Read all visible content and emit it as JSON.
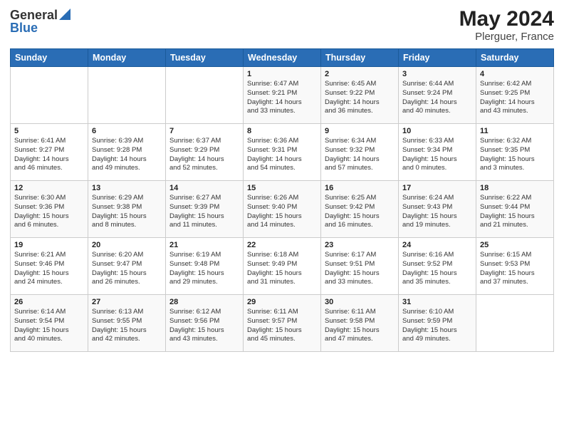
{
  "logo": {
    "general": "General",
    "blue": "Blue"
  },
  "title": {
    "month_year": "May 2024",
    "location": "Plerguer, France"
  },
  "headers": [
    "Sunday",
    "Monday",
    "Tuesday",
    "Wednesday",
    "Thursday",
    "Friday",
    "Saturday"
  ],
  "weeks": [
    [
      {
        "day": "",
        "info": ""
      },
      {
        "day": "",
        "info": ""
      },
      {
        "day": "",
        "info": ""
      },
      {
        "day": "1",
        "info": "Sunrise: 6:47 AM\nSunset: 9:21 PM\nDaylight: 14 hours\nand 33 minutes."
      },
      {
        "day": "2",
        "info": "Sunrise: 6:45 AM\nSunset: 9:22 PM\nDaylight: 14 hours\nand 36 minutes."
      },
      {
        "day": "3",
        "info": "Sunrise: 6:44 AM\nSunset: 9:24 PM\nDaylight: 14 hours\nand 40 minutes."
      },
      {
        "day": "4",
        "info": "Sunrise: 6:42 AM\nSunset: 9:25 PM\nDaylight: 14 hours\nand 43 minutes."
      }
    ],
    [
      {
        "day": "5",
        "info": "Sunrise: 6:41 AM\nSunset: 9:27 PM\nDaylight: 14 hours\nand 46 minutes."
      },
      {
        "day": "6",
        "info": "Sunrise: 6:39 AM\nSunset: 9:28 PM\nDaylight: 14 hours\nand 49 minutes."
      },
      {
        "day": "7",
        "info": "Sunrise: 6:37 AM\nSunset: 9:29 PM\nDaylight: 14 hours\nand 52 minutes."
      },
      {
        "day": "8",
        "info": "Sunrise: 6:36 AM\nSunset: 9:31 PM\nDaylight: 14 hours\nand 54 minutes."
      },
      {
        "day": "9",
        "info": "Sunrise: 6:34 AM\nSunset: 9:32 PM\nDaylight: 14 hours\nand 57 minutes."
      },
      {
        "day": "10",
        "info": "Sunrise: 6:33 AM\nSunset: 9:34 PM\nDaylight: 15 hours\nand 0 minutes."
      },
      {
        "day": "11",
        "info": "Sunrise: 6:32 AM\nSunset: 9:35 PM\nDaylight: 15 hours\nand 3 minutes."
      }
    ],
    [
      {
        "day": "12",
        "info": "Sunrise: 6:30 AM\nSunset: 9:36 PM\nDaylight: 15 hours\nand 6 minutes."
      },
      {
        "day": "13",
        "info": "Sunrise: 6:29 AM\nSunset: 9:38 PM\nDaylight: 15 hours\nand 8 minutes."
      },
      {
        "day": "14",
        "info": "Sunrise: 6:27 AM\nSunset: 9:39 PM\nDaylight: 15 hours\nand 11 minutes."
      },
      {
        "day": "15",
        "info": "Sunrise: 6:26 AM\nSunset: 9:40 PM\nDaylight: 15 hours\nand 14 minutes."
      },
      {
        "day": "16",
        "info": "Sunrise: 6:25 AM\nSunset: 9:42 PM\nDaylight: 15 hours\nand 16 minutes."
      },
      {
        "day": "17",
        "info": "Sunrise: 6:24 AM\nSunset: 9:43 PM\nDaylight: 15 hours\nand 19 minutes."
      },
      {
        "day": "18",
        "info": "Sunrise: 6:22 AM\nSunset: 9:44 PM\nDaylight: 15 hours\nand 21 minutes."
      }
    ],
    [
      {
        "day": "19",
        "info": "Sunrise: 6:21 AM\nSunset: 9:46 PM\nDaylight: 15 hours\nand 24 minutes."
      },
      {
        "day": "20",
        "info": "Sunrise: 6:20 AM\nSunset: 9:47 PM\nDaylight: 15 hours\nand 26 minutes."
      },
      {
        "day": "21",
        "info": "Sunrise: 6:19 AM\nSunset: 9:48 PM\nDaylight: 15 hours\nand 29 minutes."
      },
      {
        "day": "22",
        "info": "Sunrise: 6:18 AM\nSunset: 9:49 PM\nDaylight: 15 hours\nand 31 minutes."
      },
      {
        "day": "23",
        "info": "Sunrise: 6:17 AM\nSunset: 9:51 PM\nDaylight: 15 hours\nand 33 minutes."
      },
      {
        "day": "24",
        "info": "Sunrise: 6:16 AM\nSunset: 9:52 PM\nDaylight: 15 hours\nand 35 minutes."
      },
      {
        "day": "25",
        "info": "Sunrise: 6:15 AM\nSunset: 9:53 PM\nDaylight: 15 hours\nand 37 minutes."
      }
    ],
    [
      {
        "day": "26",
        "info": "Sunrise: 6:14 AM\nSunset: 9:54 PM\nDaylight: 15 hours\nand 40 minutes."
      },
      {
        "day": "27",
        "info": "Sunrise: 6:13 AM\nSunset: 9:55 PM\nDaylight: 15 hours\nand 42 minutes."
      },
      {
        "day": "28",
        "info": "Sunrise: 6:12 AM\nSunset: 9:56 PM\nDaylight: 15 hours\nand 43 minutes."
      },
      {
        "day": "29",
        "info": "Sunrise: 6:11 AM\nSunset: 9:57 PM\nDaylight: 15 hours\nand 45 minutes."
      },
      {
        "day": "30",
        "info": "Sunrise: 6:11 AM\nSunset: 9:58 PM\nDaylight: 15 hours\nand 47 minutes."
      },
      {
        "day": "31",
        "info": "Sunrise: 6:10 AM\nSunset: 9:59 PM\nDaylight: 15 hours\nand 49 minutes."
      },
      {
        "day": "",
        "info": ""
      }
    ]
  ]
}
